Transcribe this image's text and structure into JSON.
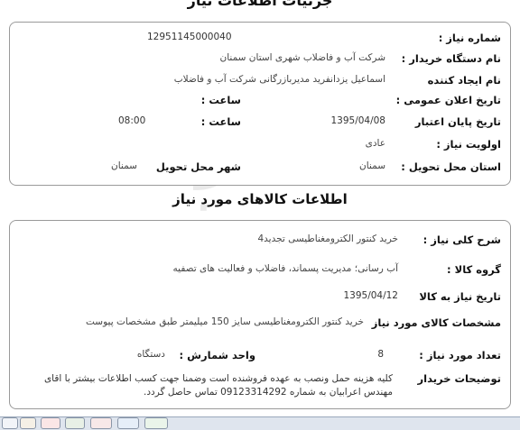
{
  "header": {
    "title": "جزئیات اطلاعات نیاز"
  },
  "tender": {
    "number_label": "شماره نیاز :",
    "number_value": "12951145000040",
    "buyer_label": "نام دستگاه خریدار :",
    "buyer_value": "شرکت آب و فاضلاب شهری استان سمنان",
    "creator_label": "نام ایجاد کننده",
    "creator_value": "اسماعیل  یزدانفرید مدیربازرگانی شرکت آب و فاضلاب",
    "announce_label": "تاریخ اعلان عمومی :",
    "announce_time_label": "ساعت :",
    "deadline_label": "تاریخ پایان اعتبار",
    "deadline_value": "1395/04/08",
    "deadline_time_label": "ساعت :",
    "deadline_time_value": "08:00",
    "priority_label": "اولویت نیاز :",
    "priority_value": "عادی",
    "province_label": "استان محل تحویل :",
    "province_value": "سمنان",
    "city_label": "شهر محل تحویل",
    "city_value": "سمنان"
  },
  "goods_section": {
    "title": "اطلاعات کالاهای مورد نیاز"
  },
  "goods": {
    "summary_label": "شرح کلی نیاز :",
    "summary_value": "خرید کنتور الکترومغناطیسی تجدید4",
    "group_label": "گروه کالا :",
    "group_value": "آب رسانی؛ مدیریت پسماند، فاضلاب و فعالیت های تصفیه",
    "need_date_label": "تاریخ نیاز به کالا",
    "need_date_value": "1395/04/12",
    "specs_label": "مشخصات کالای مورد نیاز",
    "specs_value": "خرید کنتور الکترومغناطیسی سایز 150 میلیمتر طبق مشخصات پیوست",
    "quantity_label": "تعداد مورد نیاز :",
    "quantity_value": "8",
    "unit_label": "واحد شمارش :",
    "unit_value": "دستگاه",
    "notes_label": "توضیحات خریدار",
    "notes_value": "کلیه هزینه حمل ونصب به عهده فروشنده است وضمنا جهت کسب اطلاعات بیشتر با اقای مهندس اعرابیان به شماره 09123314292 تماس حاصل گردد."
  },
  "watermark": {
    "brand": "ParsNamadData",
    "line": "پایگاه اطلاع رسانی مناقصه و مزایده",
    "phone": "۰۲۱-۸۸۳۴۹۶۷۰",
    "digits": "۰۲۱۰۱۰"
  }
}
